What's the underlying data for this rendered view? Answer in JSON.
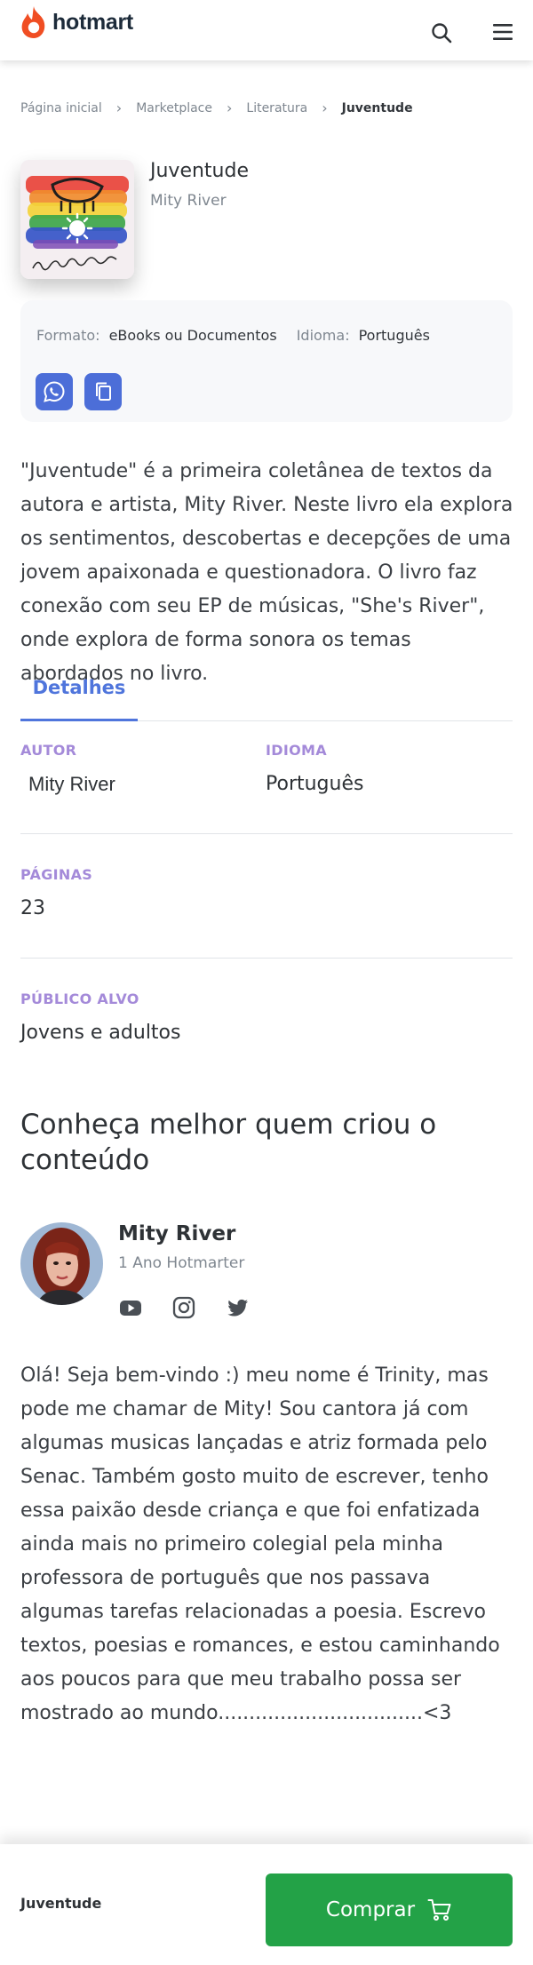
{
  "header": {
    "logo_text": "hotmart",
    "icons": [
      "hotmart-flame-icon",
      "search-icon",
      "menu-icon"
    ]
  },
  "breadcrumb": [
    "Página inicial",
    "Marketplace",
    "Literatura",
    "Juventude"
  ],
  "product": {
    "title": "Juventude",
    "author": "Mity River",
    "cover_signature": "Juventude",
    "format_label": "Formato:",
    "format_value": "eBooks ou Documentos",
    "language_label": "Idioma:",
    "language_value": "Português",
    "share_icons": [
      "whatsapp-icon",
      "copy-link-icon"
    ]
  },
  "description": "\"Juventude\" é a primeira coletânea de textos da autora e artista, Mity River. Neste livro ela explora os sentimentos, descobertas e decepções de uma jovem apaixonada e questionadora. O livro faz conexão com seu EP de músicas, \"She's River\", onde explora de forma sonora os temas abordados no livro.",
  "tabs": [
    "Detalhes"
  ],
  "details": {
    "author_label": "AUTOR",
    "author_value": "Mity River",
    "language_label": "IDIOMA",
    "language_value": "Português",
    "pages_label": "PÁGINAS",
    "pages_value": "23",
    "audience_label": "PÚBLICO ALVO",
    "audience_value": "Jovens e adultos"
  },
  "creator": {
    "section_title": "Conheça melhor quem criou o conteúdo",
    "name": "Mity River",
    "subtitle": "1 Ano Hotmarter",
    "social_icons": [
      "youtube-icon",
      "instagram-icon",
      "twitter-icon"
    ],
    "bio": "Olá! Seja bem-vindo :) meu nome é Trinity, mas pode me chamar de Mity! Sou cantora já com algumas musicas lançadas e atriz formada pelo Senac. Também gosto muito de escrever, tenho essa paixão desde criança e que foi enfatizada ainda mais no primeiro colegial pela minha professora de português que nos passava algumas tarefas relacionadas a poesia. Escrevo textos, poesias e romances, e estou caminhando aos poucos para que meu trabalho possa ser mostrado ao mundo.................................<3"
  },
  "bottom_bar": {
    "title": "Juventude",
    "buy_label": "Comprar",
    "buy_icon": "cart-icon"
  },
  "colors": {
    "brand_orange": "#f04e23",
    "accent_blue": "#4f75dc",
    "label_purple": "#a48ad9",
    "buy_green": "#23a247"
  }
}
